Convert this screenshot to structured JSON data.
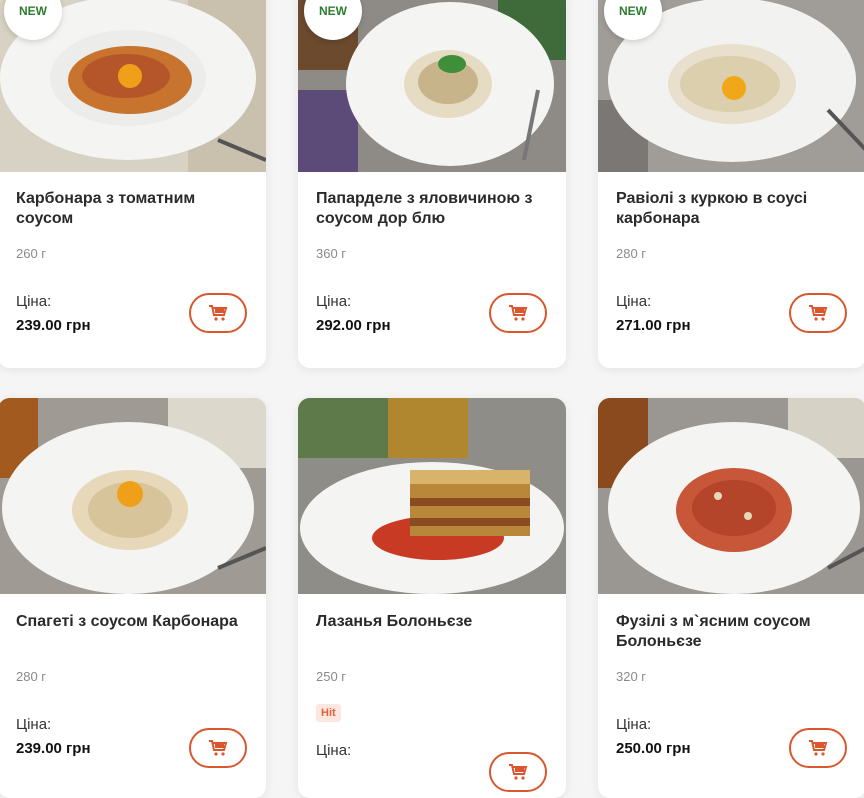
{
  "products": [
    {
      "title": "Карбонара з томатним соусом",
      "weight": "260 г",
      "price_label": "Ціна:",
      "price": "239.00 грн",
      "badge": "NEW"
    },
    {
      "title": "Папарделе з яловичиною з соусом дор блю",
      "weight": "360 г",
      "price_label": "Ціна:",
      "price": "292.00 грн",
      "badge": "NEW"
    },
    {
      "title": "Равіолі з куркою в соусі карбонара",
      "weight": "280 г",
      "price_label": "Ціна:",
      "price": "271.00 грн",
      "badge": "NEW"
    },
    {
      "title": "Спагеті з соусом Карбонара",
      "weight": "280 г",
      "price_label": "Ціна:",
      "price": "239.00 грн"
    },
    {
      "title": "Лазанья Болоньєзе",
      "weight": "250 г",
      "price_label": "Ціна:",
      "hit": "Hit"
    },
    {
      "title": "Фузілі з м`ясним соусом Болоньєзе",
      "weight": "320 г",
      "price_label": "Ціна:",
      "price": "250.00 грн"
    }
  ],
  "colors": {
    "accent": "#d9572e",
    "new_badge": "#2e7d2e",
    "hit": "#e0623a"
  },
  "icons": {
    "cart": "shopping-cart-icon"
  }
}
